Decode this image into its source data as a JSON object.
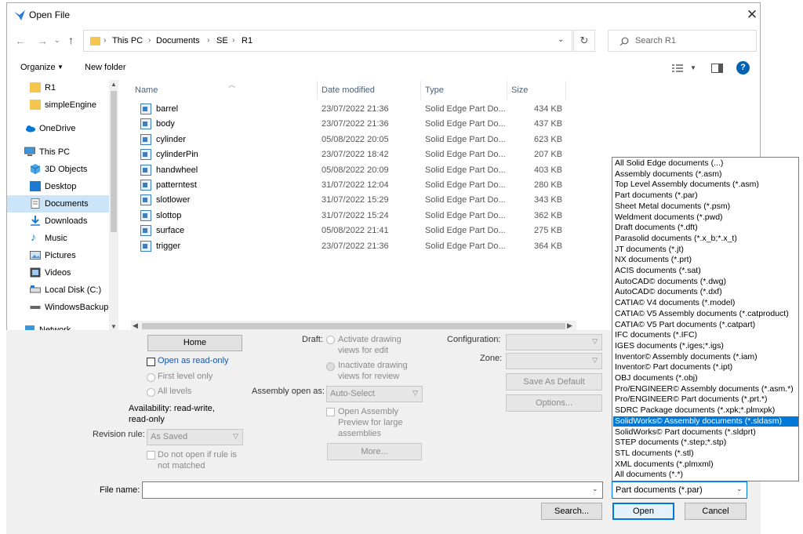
{
  "window": {
    "title": "Open File"
  },
  "address": {
    "crumbs": [
      "This PC",
      "Documents",
      "SE",
      "R1"
    ],
    "search_placeholder": "Search R1"
  },
  "toolbar": {
    "organize": "Organize",
    "new_folder": "New folder"
  },
  "sidebar": {
    "items": [
      {
        "label": "R1",
        "icon": "folder-icon"
      },
      {
        "label": "simpleEngine",
        "icon": "folder-icon"
      },
      {
        "label": "OneDrive",
        "icon": "cloud-icon"
      },
      {
        "label": "This PC",
        "icon": "computer-icon"
      },
      {
        "label": "3D Objects",
        "icon": "cube-icon"
      },
      {
        "label": "Desktop",
        "icon": "desktop-icon"
      },
      {
        "label": "Documents",
        "icon": "document-icon",
        "selected": true
      },
      {
        "label": "Downloads",
        "icon": "download-icon"
      },
      {
        "label": "Music",
        "icon": "music-icon"
      },
      {
        "label": "Pictures",
        "icon": "picture-icon"
      },
      {
        "label": "Videos",
        "icon": "video-icon"
      },
      {
        "label": "Local Disk (C:)",
        "icon": "disk-icon"
      },
      {
        "label": "WindowsBackup",
        "icon": "drive-icon"
      },
      {
        "label": "Network",
        "icon": "network-icon"
      }
    ]
  },
  "columns": {
    "name": "Name",
    "date": "Date modified",
    "type": "Type",
    "size": "Size"
  },
  "files": [
    {
      "name": "barrel",
      "date": "23/07/2022 21:36",
      "type": "Solid Edge Part Do...",
      "size": "434 KB"
    },
    {
      "name": "body",
      "date": "23/07/2022 21:36",
      "type": "Solid Edge Part Do...",
      "size": "437 KB"
    },
    {
      "name": "cylinder",
      "date": "05/08/2022 20:05",
      "type": "Solid Edge Part Do...",
      "size": "623 KB"
    },
    {
      "name": "cylinderPin",
      "date": "23/07/2022 18:42",
      "type": "Solid Edge Part Do...",
      "size": "207 KB"
    },
    {
      "name": "handwheel",
      "date": "05/08/2022 20:09",
      "type": "Solid Edge Part Do...",
      "size": "403 KB"
    },
    {
      "name": "patterntest",
      "date": "31/07/2022 12:04",
      "type": "Solid Edge Part Do...",
      "size": "280 KB"
    },
    {
      "name": "slotlower",
      "date": "31/07/2022 15:29",
      "type": "Solid Edge Part Do...",
      "size": "343 KB"
    },
    {
      "name": "slottop",
      "date": "31/07/2022 15:24",
      "type": "Solid Edge Part Do...",
      "size": "362 KB"
    },
    {
      "name": "surface",
      "date": "05/08/2022 21:41",
      "type": "Solid Edge Part Do...",
      "size": "275 KB"
    },
    {
      "name": "trigger",
      "date": "23/07/2022 21:36",
      "type": "Solid Edge Part Do...",
      "size": "364 KB"
    }
  ],
  "options": {
    "home_button": "Home",
    "open_readonly": "Open as read-only",
    "first_level": "First level only",
    "all_levels": "All levels",
    "availability": "Availability: read-write, read-only",
    "revision_rule_label": "Revision rule:",
    "revision_rule_value": "As Saved",
    "do_not_open": "Do not open if rule is not matched",
    "draft_label": "Draft:",
    "activate_drawing": "Activate drawing views for edit",
    "inactivate_drawing": "Inactivate drawing views for review",
    "assembly_open_label": "Assembly open as:",
    "assembly_open_value": "Auto-Select",
    "open_assembly_preview": "Open Assembly Preview for large assemblies",
    "more_button": "More...",
    "configuration_label": "Configuration:",
    "zone_label": "Zone:",
    "save_default_button": "Save As Default",
    "options_button": "Options..."
  },
  "bottom": {
    "file_name_label": "File name:",
    "file_name_value": "",
    "file_type_value": "Part documents (*.par)",
    "search_button": "Search...",
    "open_button": "Open",
    "cancel_button": "Cancel"
  },
  "file_types": [
    "All Solid Edge documents (...)",
    "Assembly documents (*.asm)",
    "Top Level Assembly documents (*.asm)",
    "Part documents (*.par)",
    "Sheet Metal documents (*.psm)",
    "Weldment documents (*.pwd)",
    "Draft documents (*.dft)",
    "Parasolid documents (*.x_b;*.x_t)",
    "JT documents (*.jt)",
    "NX documents (*.prt)",
    "ACIS documents (*.sat)",
    "AutoCAD© documents (*.dwg)",
    "AutoCAD© documents (*.dxf)",
    "CATIA© V4 documents (*.model)",
    "CATIA© V5 Assembly documents (*.catproduct)",
    "CATIA© V5 Part documents (*.catpart)",
    "IFC documents (*.IFC)",
    "IGES documents (*.iges;*.igs)",
    "Inventor© Assembly documents (*.iam)",
    "Inventor© Part documents (*.ipt)",
    "OBJ documents (*.obj)",
    "Pro/ENGINEER© Assembly documents (*.asm.*)",
    "Pro/ENGINEER© Part documents (*.prt.*)",
    "SDRC Package documents (*.xpk;*.plmxpk)",
    "SolidWorks© Assembly documents (*.sldasm)",
    "SolidWorks© Part documents (*.sldprt)",
    "STEP documents (*.step;*.stp)",
    "STL documents (*.stl)",
    "XML documents (*.plmxml)",
    "All documents (*.*)"
  ],
  "file_types_selected_index": 24,
  "colors": {
    "accent": "#0078d7",
    "selection": "#cce4f7",
    "folder": "#f5c64d",
    "panel": "#f0f0f0"
  }
}
